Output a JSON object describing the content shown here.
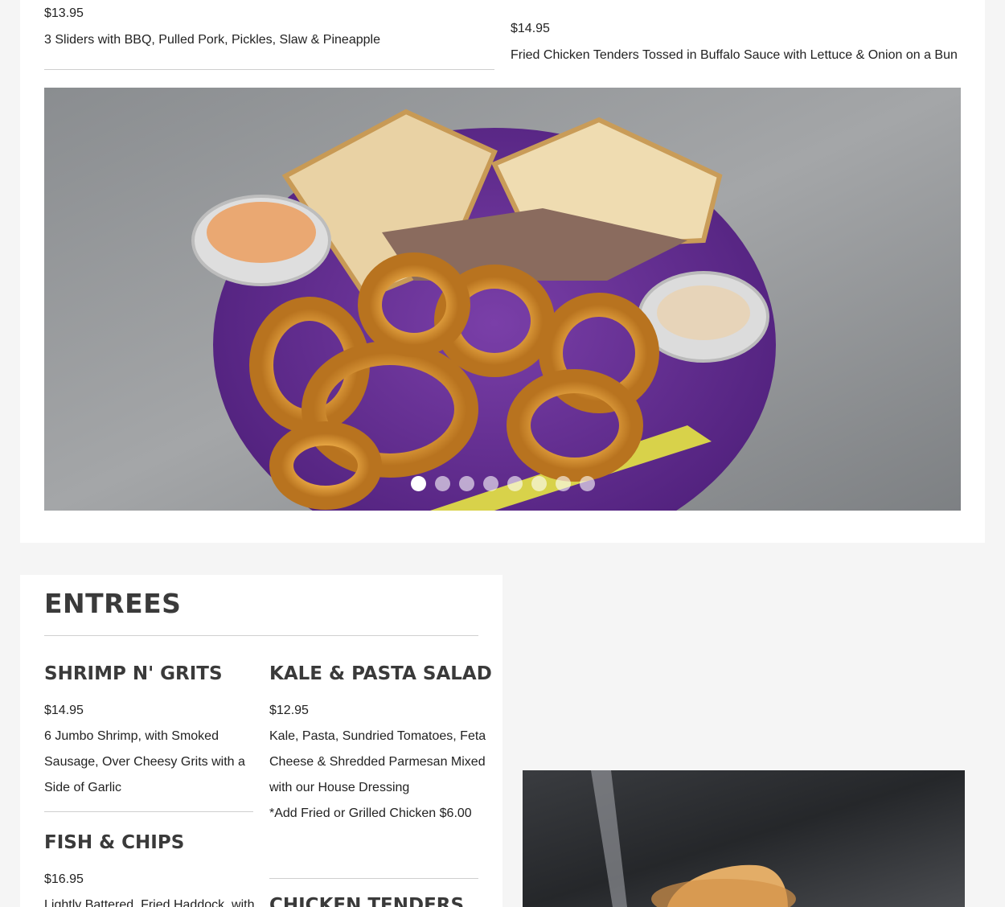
{
  "top_left_item": {
    "price": "$13.95",
    "description": "3 Sliders with BBQ, Pulled Pork, Pickles, Slaw & Pineapple"
  },
  "top_right_item": {
    "price": "$14.95",
    "description": "Fried Chicken Tenders Tossed in Buffalo Sauce with Lettuce & Onion on a Bun"
  },
  "carousel": {
    "slide_count": 8,
    "active_index": 0,
    "image": "sandwich-with-onion-rings-photo"
  },
  "entrees": {
    "title": "ENTREES",
    "items": [
      {
        "name": "SHRIMP N' GRITS",
        "price": "$14.95",
        "description_lines": [
          "6 Jumbo Shrimp, with Smoked",
          "Sausage, Over Cheesy Grits with a",
          "Side of Garlic"
        ]
      },
      {
        "name": "KALE & PASTA SALAD",
        "price": "$12.95",
        "description_lines": [
          "Kale, Pasta, Sundried Tomatoes, Feta",
          "Cheese & Shredded Parmesan Mixed",
          "with our House Dressing"
        ],
        "note": "*Add Fried or Grilled Chicken $6.00"
      },
      {
        "name": "FISH & CHIPS",
        "price": "$16.95",
        "description_lines": [
          "Lightly Battered, Fried Haddock, with"
        ]
      },
      {
        "name": "CHICKEN TENDERS"
      }
    ]
  },
  "side_photo": {
    "image": "sandwich-photo"
  }
}
